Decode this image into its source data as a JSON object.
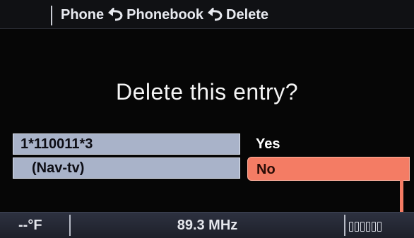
{
  "header": {
    "crumbs": [
      "Phone",
      "Phonebook",
      "Delete"
    ],
    "separator_icon": "return-arrow-icon"
  },
  "dialog": {
    "question": "Delete this entry?",
    "entry_number": "1*110011*3",
    "entry_name": "(Nav-tv)"
  },
  "options": {
    "yes_label": "Yes",
    "no_label": "No",
    "selected": "No"
  },
  "status": {
    "temperature": "--°F",
    "frequency": "89.3 MHz",
    "signal_icon": "signal-strength-icon"
  },
  "colors": {
    "selection": "#f47c64",
    "entry_box": "#a9b3c9",
    "background": "#060606"
  }
}
